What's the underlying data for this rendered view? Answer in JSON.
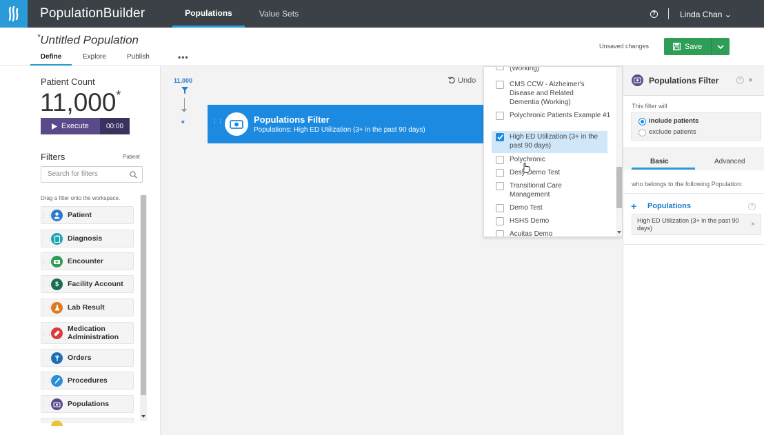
{
  "app": {
    "brand": "PopulationBuilder",
    "nav": [
      "Populations",
      "Value Sets"
    ],
    "help": "?",
    "user": "Linda Chan ⌄",
    "colors": {
      "topbar": "#3c4147",
      "accent": "#2a9bd8",
      "save": "#2e9e56",
      "execute": "#5a4a8a",
      "card": "#1c8ae0"
    }
  },
  "subheader": {
    "title_marker": "*",
    "title": "Untitled Population",
    "tabs": [
      "Define",
      "Explore",
      "Publish"
    ],
    "more": "•••",
    "unsaved": "Unsaved changes",
    "save_label": "Save"
  },
  "left": {
    "patient_count_label": "Patient Count",
    "patient_count": "11,000",
    "patient_count_marker": "*",
    "execute_label": "Execute",
    "execute_time": "00:00",
    "filters_title": "Filters",
    "filters_scope": "Patient",
    "search_placeholder": "Search for filters",
    "drag_hint": "Drag a filter onto the workspace.",
    "filters": [
      {
        "label": "Patient",
        "icon": "person-icon",
        "color": "#2a7bd0"
      },
      {
        "label": "Diagnosis",
        "icon": "clipboard-icon",
        "color": "#1aa3b0"
      },
      {
        "label": "Encounter",
        "icon": "encounter-icon",
        "color": "#2e9e56"
      },
      {
        "label": "Facility Account",
        "icon": "dollar-icon",
        "color": "#1b6e4f"
      },
      {
        "label": "Lab Result",
        "icon": "flask-icon",
        "color": "#e07a1f"
      },
      {
        "label": "Medication Administration",
        "icon": "pill-icon",
        "color": "#d93a3a"
      },
      {
        "label": "Orders",
        "icon": "caduceus-icon",
        "color": "#1c6fb4"
      },
      {
        "label": "Procedures",
        "icon": "procedure-icon",
        "color": "#2a8fd8"
      },
      {
        "label": "Populations",
        "icon": "populations-icon",
        "color": "#5a4a8a"
      }
    ]
  },
  "workspace": {
    "count": "11,000",
    "star": "*",
    "undo": "Undo",
    "card_title": "Populations Filter",
    "card_sub": "Populations: High ED Utilization (3+ in the past 90 days)"
  },
  "dropdown": {
    "items": [
      {
        "label": "(Working)",
        "checked": false
      },
      {
        "label": "CMS CCW - Alzheimer's Disease and Related Dementia (Working)",
        "checked": false
      },
      {
        "label": "Polychronic Patients Example #1",
        "checked": false
      },
      {
        "label": "High ED Utilization (3+ in the past 90 days)",
        "checked": true
      },
      {
        "label": "Polychronic",
        "checked": false
      },
      {
        "label": "Desy Demo Test",
        "checked": false
      },
      {
        "label": "Transitional Care Management",
        "checked": false
      },
      {
        "label": "Demo Test",
        "checked": false
      },
      {
        "label": "HSHS Demo",
        "checked": false
      },
      {
        "label": "Acuitas Demo",
        "checked": false
      }
    ]
  },
  "right": {
    "title": "Populations Filter",
    "help": "?",
    "close": "×",
    "will": "This filter will",
    "include": "include patients",
    "exclude": "exclude patients",
    "tabs": [
      "Basic",
      "Advanced"
    ],
    "belongs": "who belongs to the following Population:",
    "plus": "+",
    "pops_label": "Populations",
    "chip": "High ED Utilization (3+ in the past 90 days)",
    "chip_close": "×"
  }
}
